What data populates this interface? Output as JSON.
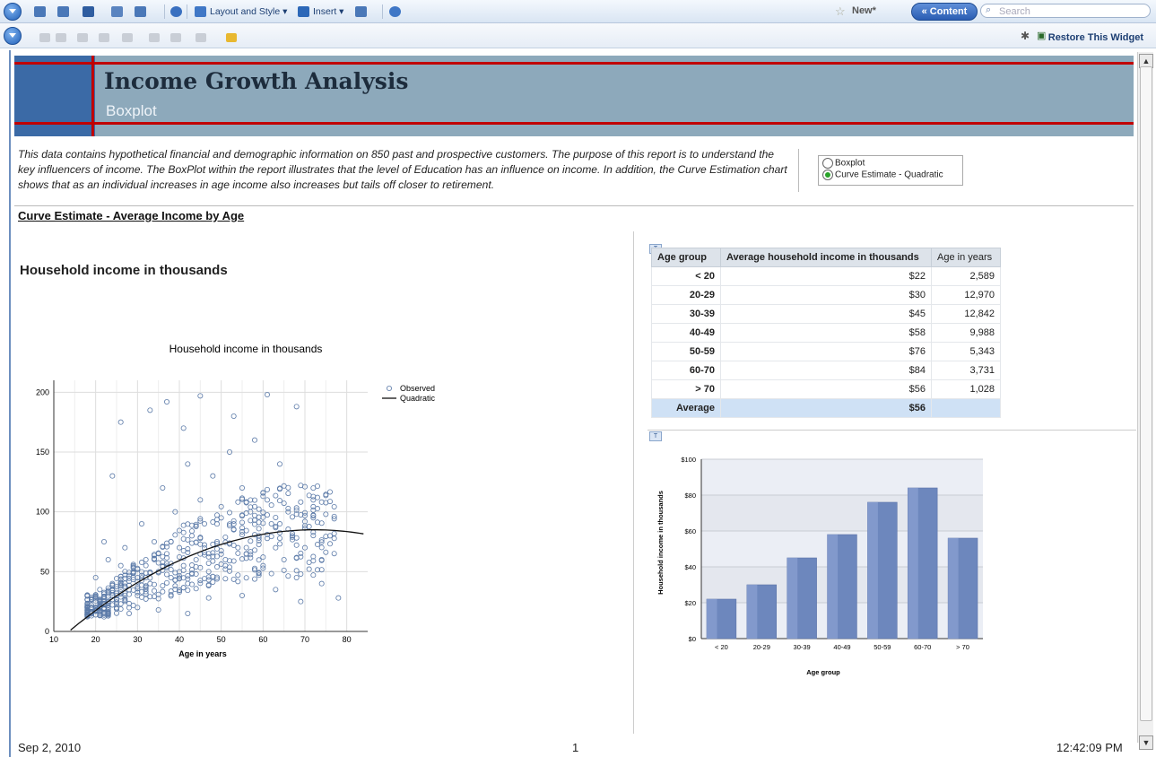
{
  "toolbar": {
    "layout_label": "Layout and Style ▾",
    "insert_label": "Insert ▾",
    "new_label": "New*",
    "content_label": "« Content",
    "search_placeholder": "Search",
    "restore_label": "Restore This Widget"
  },
  "report": {
    "title": "Income Growth Analysis",
    "subtitle": "Boxplot",
    "description": "This data contains hypothetical financial and demographic information on 850 past and prospective customers. The purpose of this report is to understand the key influencers of income. The BoxPlot within the report illustrates that the level of Education has an influence on income. In addition, the Curve Estimation chart shows that as an individual increases in age income also increases but tails off closer to retirement.",
    "radio_options": [
      "Boxplot",
      "Curve Estimate - Quadratic"
    ],
    "radio_selected": 1,
    "section_title": "Curve Estimate - Average Income by Age",
    "chart_heading": "Household income in thousands"
  },
  "table": {
    "headers": [
      "Age group",
      "Average household income in thousands",
      "Age in years"
    ],
    "rows": [
      [
        "< 20",
        "$22",
        "2,589"
      ],
      [
        "20-29",
        "$30",
        "12,970"
      ],
      [
        "30-39",
        "$45",
        "12,842"
      ],
      [
        "40-49",
        "$58",
        "9,988"
      ],
      [
        "50-59",
        "$76",
        "5,343"
      ],
      [
        "60-70",
        "$84",
        "3,731"
      ],
      [
        "> 70",
        "$56",
        "1,028"
      ]
    ],
    "average": [
      "Average",
      "$56",
      ""
    ]
  },
  "footer": {
    "date": "Sep 2, 2010",
    "page": "1",
    "time": "12:42:09 PM"
  },
  "chart_data": [
    {
      "type": "scatter",
      "title": "Household income in thousands",
      "xlabel": "Age in years",
      "ylabel": "",
      "xlim": [
        10,
        85
      ],
      "ylim": [
        0,
        210
      ],
      "xticks": [
        10,
        20,
        30,
        40,
        50,
        60,
        70,
        80
      ],
      "yticks": [
        0,
        50,
        100,
        150,
        200
      ],
      "legend": [
        "Observed",
        "Quadratic"
      ],
      "legend_position": "top-right",
      "grid": true,
      "quadratic_fit": {
        "intercept": -44,
        "b1": 3.57,
        "b2": -0.0247,
        "x_range": [
          18,
          84
        ]
      },
      "observed_sample": [
        [
          18,
          30
        ],
        [
          19,
          22
        ],
        [
          20,
          45
        ],
        [
          21,
          35
        ],
        [
          22,
          25
        ],
        [
          23,
          60
        ],
        [
          24,
          40
        ],
        [
          25,
          30
        ],
        [
          26,
          55
        ],
        [
          27,
          70
        ],
        [
          28,
          35
        ],
        [
          29,
          50
        ],
        [
          30,
          45
        ],
        [
          31,
          90
        ],
        [
          32,
          60
        ],
        [
          33,
          40
        ],
        [
          34,
          75
        ],
        [
          35,
          50
        ],
        [
          36,
          120
        ],
        [
          37,
          65
        ],
        [
          38,
          45
        ],
        [
          39,
          100
        ],
        [
          40,
          70
        ],
        [
          41,
          55
        ],
        [
          42,
          140
        ],
        [
          43,
          80
        ],
        [
          44,
          60
        ],
        [
          45,
          110
        ],
        [
          46,
          90
        ],
        [
          47,
          50
        ],
        [
          48,
          130
        ],
        [
          49,
          75
        ],
        [
          50,
          95
        ],
        [
          51,
          60
        ],
        [
          52,
          150
        ],
        [
          53,
          85
        ],
        [
          54,
          70
        ],
        [
          55,
          120
        ],
        [
          56,
          65
        ],
        [
          57,
          100
        ],
        [
          58,
          160
        ],
        [
          59,
          80
        ],
        [
          60,
          55
        ],
        [
          61,
          110
        ],
        [
          62,
          90
        ],
        [
          63,
          70
        ],
        [
          64,
          140
        ],
        [
          65,
          60
        ],
        [
          66,
          100
        ],
        [
          67,
          80
        ],
        [
          68,
          45
        ],
        [
          70,
          70
        ],
        [
          72,
          110
        ],
        [
          74,
          60
        ],
        [
          76,
          80
        ],
        [
          78,
          28
        ],
        [
          22,
          75
        ],
        [
          24,
          130
        ],
        [
          26,
          175
        ],
        [
          33,
          185
        ],
        [
          37,
          192
        ],
        [
          41,
          170
        ],
        [
          45,
          197
        ],
        [
          53,
          180
        ],
        [
          61,
          198
        ],
        [
          68,
          188
        ],
        [
          28,
          15
        ],
        [
          30,
          20
        ],
        [
          35,
          18
        ],
        [
          42,
          15
        ],
        [
          47,
          28
        ],
        [
          55,
          30
        ],
        [
          63,
          35
        ],
        [
          69,
          25
        ],
        [
          74,
          40
        ]
      ]
    },
    {
      "type": "bar",
      "title": "",
      "categories": [
        "< 20",
        "20-29",
        "30-39",
        "40-49",
        "50-59",
        "60-70",
        "> 70"
      ],
      "values": [
        22,
        30,
        45,
        58,
        76,
        84,
        56
      ],
      "xlabel": "Age group",
      "ylabel": "Household income in thousands",
      "ylim": [
        0,
        100
      ],
      "yticks": [
        "$0",
        "$20",
        "$40",
        "$60",
        "$80",
        "$100"
      ]
    }
  ],
  "colors": {
    "banner": "#8da9bb",
    "banner_left": "#3b6aa6",
    "red_rule": "#c00000",
    "bar": "#6d87bd",
    "point": "#5b7aa8"
  }
}
